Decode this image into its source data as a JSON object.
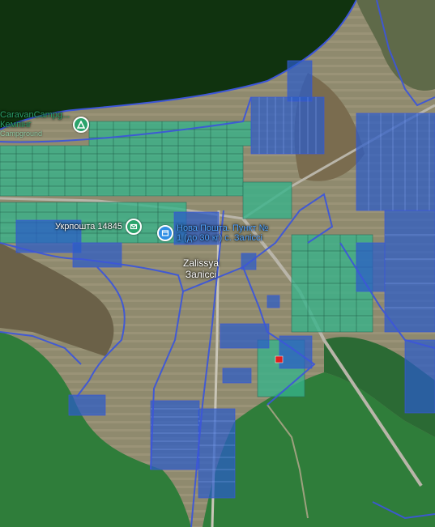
{
  "colors": {
    "lake": "#10330f",
    "forest": "#2f7d3a",
    "fields": "#8c8466",
    "boundary": "#3d56d8",
    "parcel_blue": "#2a5cc9",
    "parcel_green": "#36b48a",
    "parcel_highlight": "#e0201f",
    "poi_green": "#2ba36b",
    "poi_blue": "#2f8de4",
    "road": "#b9b5a9"
  },
  "pois": [
    {
      "key": "campground",
      "label": "CaravanCampg...",
      "label_line2": "Кемпінг",
      "sub": "Campground",
      "icon": "campground-tent-icon",
      "color": "#2ba36b"
    },
    {
      "key": "ukrposhta",
      "label": "Укрпошта 14845",
      "icon": "post-office-icon",
      "color": "#2ba36b"
    },
    {
      "key": "novaposhta",
      "label": "Нова Пошта. Пункт №",
      "label_line2": "1 (до 30 кг) с. Заліссі",
      "icon": "parcel-point-icon",
      "color": "#2f8de4"
    }
  ],
  "village": {
    "name_latin": "Zalissya",
    "name_local": "Заліссі"
  }
}
